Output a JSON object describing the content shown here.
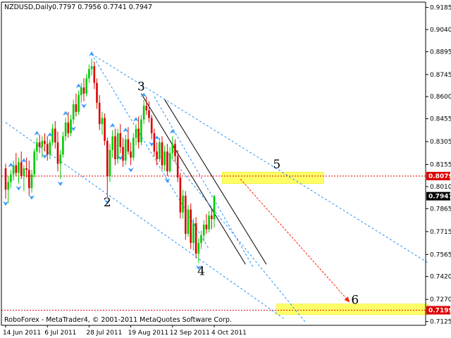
{
  "header": {
    "symbol_period": "NZDUSD,Daily",
    "ohlc": "0.7797 0.7956 0.7741 0.7947"
  },
  "footer": {
    "credit": "RoboForex - MetaTrader4, © 2001-2011 MetaQuotes Software Corp."
  },
  "colors": {
    "background": "#ffffff",
    "bull_candle": "#00cc00",
    "bear_candle": "#dd0000",
    "trend_line": "#1e90ff",
    "channel_line": "#000000",
    "zone_fill": "#ffff66",
    "level_line": "#dd0000",
    "forecast_arrow": "#ff2200",
    "fractal_marker": "#3399ff",
    "current_price_box": "#000000",
    "level_price_box": "#dd0000"
  },
  "chart_data": {
    "type": "candlestick",
    "symbol": "NZDUSD",
    "timeframe": "Daily",
    "y_axis": {
      "range": [
        0.71,
        0.922
      ],
      "ticks": [
        "0.9185",
        "0.9040",
        "0.8895",
        "0.8745",
        "0.8600",
        "0.8455",
        "0.8305",
        "0.8155",
        "0.8010",
        "0.7865",
        "0.7715",
        "0.7565",
        "0.7420",
        "0.7270",
        "0.7125"
      ],
      "current_price": "0.7947",
      "level_price": "0.8079"
    },
    "x_axis": {
      "ticks": [
        "14 Jun 2011",
        "6 Jul 2011",
        "28 Jul 2011",
        "19 Aug 2011",
        "12 Sep 2011",
        "4 Oct 2011"
      ]
    },
    "candles": [
      {
        "o": 0.813,
        "h": 0.816,
        "l": 0.793,
        "c": 0.799
      },
      {
        "o": 0.799,
        "h": 0.808,
        "l": 0.79,
        "c": 0.804
      },
      {
        "o": 0.804,
        "h": 0.812,
        "l": 0.8,
        "c": 0.809
      },
      {
        "o": 0.809,
        "h": 0.818,
        "l": 0.805,
        "c": 0.815
      },
      {
        "o": 0.815,
        "h": 0.823,
        "l": 0.808,
        "c": 0.81
      },
      {
        "o": 0.81,
        "h": 0.82,
        "l": 0.803,
        "c": 0.817
      },
      {
        "o": 0.817,
        "h": 0.824,
        "l": 0.806,
        "c": 0.808
      },
      {
        "o": 0.808,
        "h": 0.815,
        "l": 0.798,
        "c": 0.813
      },
      {
        "o": 0.813,
        "h": 0.82,
        "l": 0.807,
        "c": 0.812
      },
      {
        "o": 0.812,
        "h": 0.818,
        "l": 0.795,
        "c": 0.8
      },
      {
        "o": 0.8,
        "h": 0.812,
        "l": 0.797,
        "c": 0.809
      },
      {
        "o": 0.809,
        "h": 0.826,
        "l": 0.807,
        "c": 0.824
      },
      {
        "o": 0.824,
        "h": 0.833,
        "l": 0.818,
        "c": 0.83
      },
      {
        "o": 0.83,
        "h": 0.835,
        "l": 0.823,
        "c": 0.827
      },
      {
        "o": 0.827,
        "h": 0.834,
        "l": 0.82,
        "c": 0.831
      },
      {
        "o": 0.831,
        "h": 0.836,
        "l": 0.824,
        "c": 0.829
      },
      {
        "o": 0.829,
        "h": 0.834,
        "l": 0.818,
        "c": 0.822
      },
      {
        "o": 0.822,
        "h": 0.832,
        "l": 0.819,
        "c": 0.83
      },
      {
        "o": 0.83,
        "h": 0.842,
        "l": 0.828,
        "c": 0.839
      },
      {
        "o": 0.839,
        "h": 0.844,
        "l": 0.826,
        "c": 0.83
      },
      {
        "o": 0.83,
        "h": 0.837,
        "l": 0.811,
        "c": 0.816
      },
      {
        "o": 0.816,
        "h": 0.825,
        "l": 0.806,
        "c": 0.822
      },
      {
        "o": 0.822,
        "h": 0.837,
        "l": 0.82,
        "c": 0.834
      },
      {
        "o": 0.834,
        "h": 0.846,
        "l": 0.831,
        "c": 0.843
      },
      {
        "o": 0.843,
        "h": 0.85,
        "l": 0.833,
        "c": 0.836
      },
      {
        "o": 0.836,
        "h": 0.848,
        "l": 0.834,
        "c": 0.845
      },
      {
        "o": 0.845,
        "h": 0.858,
        "l": 0.842,
        "c": 0.855
      },
      {
        "o": 0.855,
        "h": 0.862,
        "l": 0.847,
        "c": 0.85
      },
      {
        "o": 0.85,
        "h": 0.864,
        "l": 0.848,
        "c": 0.861
      },
      {
        "o": 0.861,
        "h": 0.869,
        "l": 0.856,
        "c": 0.866
      },
      {
        "o": 0.866,
        "h": 0.872,
        "l": 0.857,
        "c": 0.862
      },
      {
        "o": 0.862,
        "h": 0.875,
        "l": 0.86,
        "c": 0.872
      },
      {
        "o": 0.872,
        "h": 0.881,
        "l": 0.869,
        "c": 0.878
      },
      {
        "o": 0.878,
        "h": 0.885,
        "l": 0.874,
        "c": 0.88
      },
      {
        "o": 0.88,
        "h": 0.883,
        "l": 0.865,
        "c": 0.869
      },
      {
        "o": 0.869,
        "h": 0.872,
        "l": 0.852,
        "c": 0.856
      },
      {
        "o": 0.856,
        "h": 0.861,
        "l": 0.838,
        "c": 0.842
      },
      {
        "o": 0.842,
        "h": 0.85,
        "l": 0.835,
        "c": 0.846
      },
      {
        "o": 0.846,
        "h": 0.849,
        "l": 0.828,
        "c": 0.831
      },
      {
        "o": 0.831,
        "h": 0.833,
        "l": 0.794,
        "c": 0.808
      },
      {
        "o": 0.808,
        "h": 0.829,
        "l": 0.804,
        "c": 0.825
      },
      {
        "o": 0.825,
        "h": 0.838,
        "l": 0.82,
        "c": 0.834
      },
      {
        "o": 0.834,
        "h": 0.839,
        "l": 0.815,
        "c": 0.819
      },
      {
        "o": 0.819,
        "h": 0.839,
        "l": 0.816,
        "c": 0.836
      },
      {
        "o": 0.836,
        "h": 0.842,
        "l": 0.823,
        "c": 0.827
      },
      {
        "o": 0.827,
        "h": 0.833,
        "l": 0.814,
        "c": 0.818
      },
      {
        "o": 0.818,
        "h": 0.835,
        "l": 0.815,
        "c": 0.832
      },
      {
        "o": 0.832,
        "h": 0.84,
        "l": 0.822,
        "c": 0.824
      },
      {
        "o": 0.824,
        "h": 0.83,
        "l": 0.815,
        "c": 0.82
      },
      {
        "o": 0.82,
        "h": 0.836,
        "l": 0.818,
        "c": 0.833
      },
      {
        "o": 0.833,
        "h": 0.842,
        "l": 0.828,
        "c": 0.839
      },
      {
        "o": 0.839,
        "h": 0.847,
        "l": 0.826,
        "c": 0.83
      },
      {
        "o": 0.83,
        "h": 0.848,
        "l": 0.828,
        "c": 0.845
      },
      {
        "o": 0.845,
        "h": 0.858,
        "l": 0.842,
        "c": 0.854
      },
      {
        "o": 0.854,
        "h": 0.86,
        "l": 0.848,
        "c": 0.851
      },
      {
        "o": 0.851,
        "h": 0.857,
        "l": 0.843,
        "c": 0.846
      },
      {
        "o": 0.846,
        "h": 0.848,
        "l": 0.832,
        "c": 0.836
      },
      {
        "o": 0.836,
        "h": 0.839,
        "l": 0.821,
        "c": 0.824
      },
      {
        "o": 0.824,
        "h": 0.83,
        "l": 0.815,
        "c": 0.819
      },
      {
        "o": 0.819,
        "h": 0.833,
        "l": 0.817,
        "c": 0.83
      },
      {
        "o": 0.83,
        "h": 0.834,
        "l": 0.812,
        "c": 0.815
      },
      {
        "o": 0.815,
        "h": 0.828,
        "l": 0.811,
        "c": 0.824
      },
      {
        "o": 0.824,
        "h": 0.829,
        "l": 0.808,
        "c": 0.811
      },
      {
        "o": 0.811,
        "h": 0.827,
        "l": 0.81,
        "c": 0.823
      },
      {
        "o": 0.823,
        "h": 0.834,
        "l": 0.819,
        "c": 0.829
      },
      {
        "o": 0.829,
        "h": 0.832,
        "l": 0.817,
        "c": 0.821
      },
      {
        "o": 0.821,
        "h": 0.825,
        "l": 0.804,
        "c": 0.807
      },
      {
        "o": 0.807,
        "h": 0.81,
        "l": 0.78,
        "c": 0.784
      },
      {
        "o": 0.784,
        "h": 0.799,
        "l": 0.78,
        "c": 0.795
      },
      {
        "o": 0.795,
        "h": 0.798,
        "l": 0.766,
        "c": 0.77
      },
      {
        "o": 0.77,
        "h": 0.789,
        "l": 0.768,
        "c": 0.786
      },
      {
        "o": 0.786,
        "h": 0.79,
        "l": 0.76,
        "c": 0.764
      },
      {
        "o": 0.764,
        "h": 0.78,
        "l": 0.759,
        "c": 0.777
      },
      {
        "o": 0.777,
        "h": 0.781,
        "l": 0.754,
        "c": 0.757
      },
      {
        "o": 0.757,
        "h": 0.767,
        "l": 0.751,
        "c": 0.764
      },
      {
        "o": 0.764,
        "h": 0.772,
        "l": 0.76,
        "c": 0.769
      },
      {
        "o": 0.769,
        "h": 0.779,
        "l": 0.765,
        "c": 0.776
      },
      {
        "o": 0.776,
        "h": 0.783,
        "l": 0.77,
        "c": 0.773
      },
      {
        "o": 0.773,
        "h": 0.785,
        "l": 0.771,
        "c": 0.782
      },
      {
        "o": 0.782,
        "h": 0.786,
        "l": 0.773,
        "c": 0.7797
      },
      {
        "o": 0.7797,
        "h": 0.7956,
        "l": 0.7741,
        "c": 0.7947
      }
    ],
    "fractals_up": [
      2,
      7,
      12,
      17,
      23,
      28,
      33,
      41,
      46,
      50,
      53,
      58,
      64
    ],
    "fractals_down": [
      0,
      5,
      10,
      15,
      21,
      26,
      30,
      39,
      44,
      48,
      56,
      62,
      74
    ],
    "wave_labels": [
      {
        "label": "2",
        "bar": 39,
        "price": 0.788
      },
      {
        "label": "3",
        "bar": 52,
        "price": 0.864
      },
      {
        "label": "4",
        "bar": 75,
        "price": 0.743
      },
      {
        "label": "5",
        "bar": 104,
        "price": 0.813
      },
      {
        "label": "6",
        "bar": 134,
        "price": 0.724
      }
    ],
    "zones": [
      {
        "bar_from": 83,
        "bar_to": 122,
        "price_top": 0.8105,
        "price_bottom": 0.803
      },
      {
        "bar_from": 104,
        "bar_to": 162,
        "price_top": 0.724,
        "price_bottom": 0.717
      }
    ],
    "horizontal_levels": [
      {
        "price": 0.8079,
        "style": "dotted",
        "label": "0.8079"
      },
      {
        "price": 0.7199,
        "style": "dotted",
        "label": "0.7199"
      }
    ],
    "trend_lines": [
      {
        "from_bar": 33,
        "from_price": 0.888,
        "to_bar": 162,
        "to_price": 0.751,
        "style": "dashed",
        "color": "trend"
      },
      {
        "from_bar": 33,
        "from_price": 0.888,
        "to_bar": 78,
        "to_price": 0.76,
        "style": "dashed",
        "color": "trend"
      },
      {
        "from_bar": 0,
        "from_price": 0.843,
        "to_bar": 107,
        "to_price": 0.714,
        "style": "dashed",
        "color": "trend"
      },
      {
        "from_bar": 52,
        "from_price": 0.862,
        "to_bar": 92,
        "to_price": 0.75,
        "style": "solid",
        "color": "channel"
      },
      {
        "from_bar": 61,
        "from_price": 0.858,
        "to_bar": 100,
        "to_price": 0.75,
        "style": "solid",
        "color": "channel"
      },
      {
        "from_bar": 57,
        "from_price": 0.86,
        "to_bar": 95,
        "to_price": 0.748,
        "style": "dashed",
        "color": "trend"
      },
      {
        "from_bar": 62,
        "from_price": 0.823,
        "to_bar": 115,
        "to_price": 0.712,
        "style": "dashed",
        "color": "trend"
      }
    ],
    "forecast_arrow": {
      "from_bar": 90,
      "from_price": 0.806,
      "to_bar": 132,
      "to_price": 0.725
    }
  }
}
